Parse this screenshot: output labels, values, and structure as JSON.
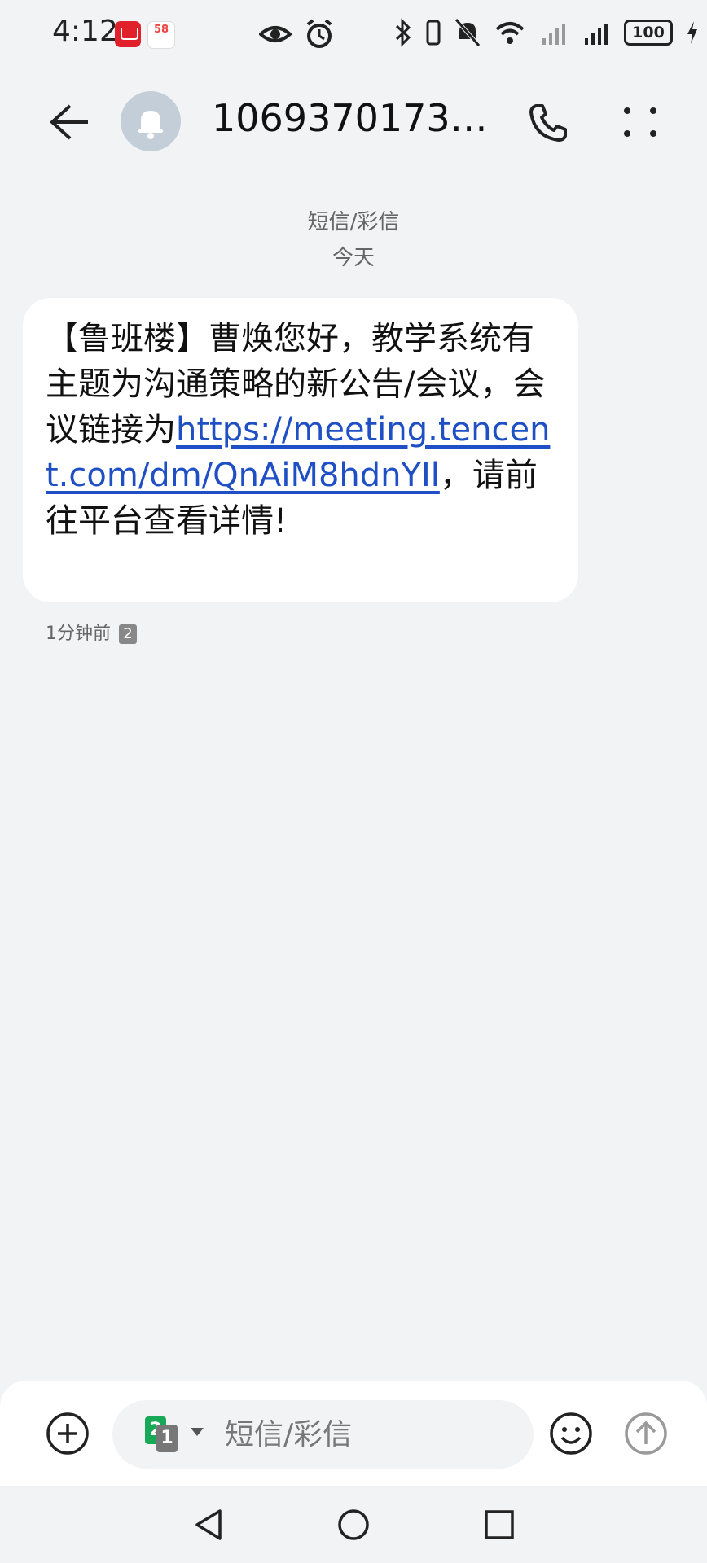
{
  "status_bar": {
    "time": "4:12",
    "badge_58_text": "58",
    "battery_level": "100"
  },
  "header": {
    "contact": "10693701739...",
    "icons": [
      "back-arrow-icon",
      "bell-icon",
      "phone-icon",
      "more-vertical-icon"
    ]
  },
  "conversation": {
    "message_type": "短信/彩信",
    "date_label": "今天"
  },
  "message": {
    "text_before_link": "【鲁班楼】曹焕您好，教学系统有主题为沟通策略的新公告/会议，会议链接为",
    "link": "https://meeting.tencent.com/dm/QnAiM8hdnYIl",
    "text_after_link": "，请前往平台查看详情!",
    "time": "1分钟前",
    "sim_slot": "2"
  },
  "composer": {
    "sim_primary": "2",
    "sim_secondary": "1",
    "placeholder": "短信/彩信",
    "icons": [
      "add-icon",
      "emoji-icon",
      "send-icon"
    ]
  },
  "colors": {
    "background": "#f1f3f5",
    "link": "#1f4fc4",
    "sim_green": "#18a957"
  }
}
